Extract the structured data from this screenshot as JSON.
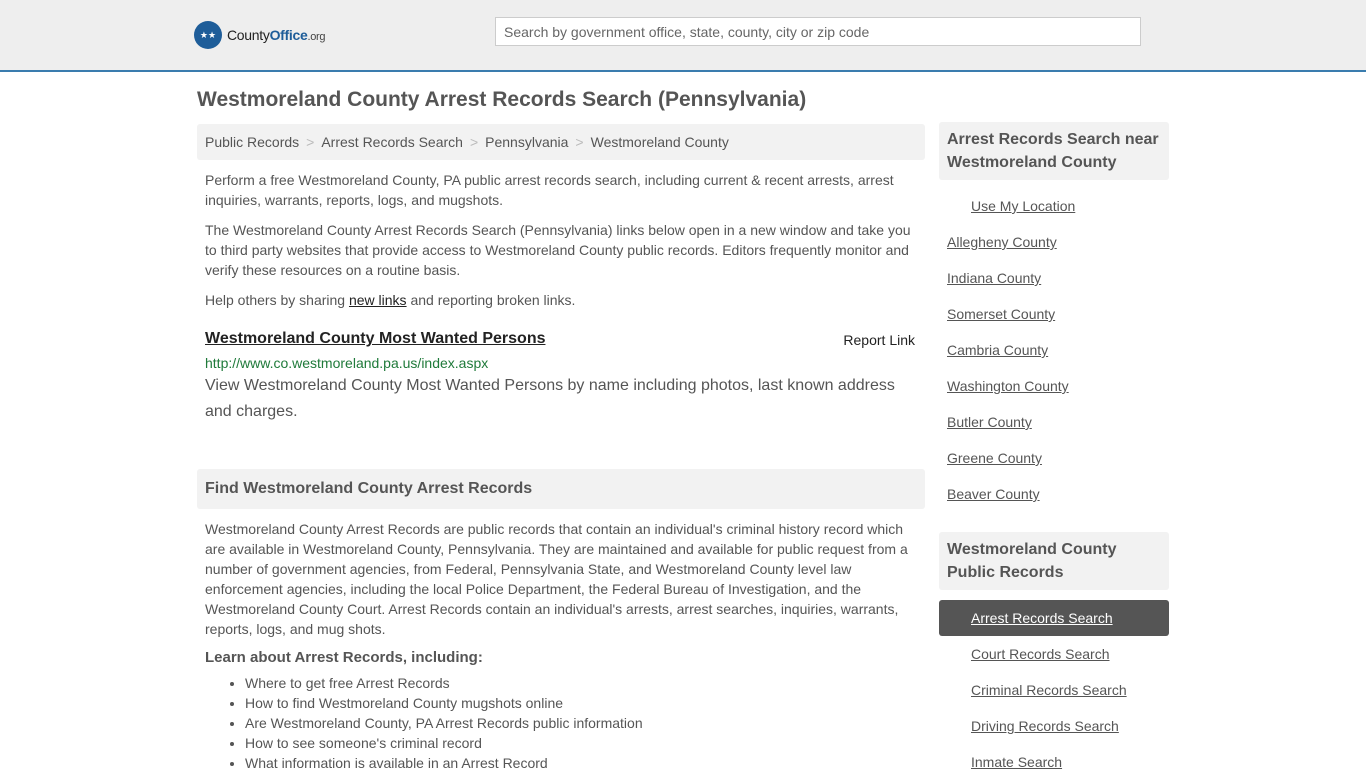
{
  "header": {
    "logo_icon": "eagle-stars-badge-icon",
    "logo_text_county": "County",
    "logo_text_office": "Office",
    "logo_text_org": ".org",
    "search_placeholder": "Search by government office, state, county, city or zip code"
  },
  "page_title": "Westmoreland County Arrest Records Search (Pennsylvania)",
  "breadcrumb": [
    {
      "label": "Public Records"
    },
    {
      "label": "Arrest Records Search"
    },
    {
      "label": "Pennsylvania"
    },
    {
      "label": "Westmoreland County"
    }
  ],
  "breadcrumb_separator": ">",
  "intro": {
    "p1": "Perform a free Westmoreland County, PA public arrest records search, including current & recent arrests, arrest inquiries, warrants, reports, logs, and mugshots.",
    "p2": "The Westmoreland County Arrest Records Search (Pennsylvania) links below open in a new window and take you to third party websites that provide access to Westmoreland County public records. Editors frequently monitor and verify these resources on a routine basis.",
    "p3_before": "Help others by sharing ",
    "p3_link": "new links",
    "p3_after": " and reporting broken links."
  },
  "resource": {
    "title": "Westmoreland County Most Wanted Persons",
    "report_label": "Report Link",
    "url": "http://www.co.westmoreland.pa.us/index.aspx",
    "description": "View Westmoreland County Most Wanted Persons by name including photos, last known address and charges."
  },
  "find_section": {
    "heading": "Find Westmoreland County Arrest Records",
    "body": "Westmoreland County Arrest Records are public records that contain an individual's criminal history record which are available in Westmoreland County, Pennsylvania. They are maintained and available for public request from a number of government agencies, from Federal, Pennsylvania State, and Westmoreland County level law enforcement agencies, including the local Police Department, the Federal Bureau of Investigation, and the Westmoreland County Court. Arrest Records contain an individual's arrests, arrest searches, inquiries, warrants, reports, logs, and mug shots.",
    "learn_heading": "Learn about Arrest Records, including:",
    "learn_items": [
      "Where to get free Arrest Records",
      "How to find Westmoreland County mugshots online",
      "Are Westmoreland County, PA Arrest Records public information",
      "How to see someone's criminal record",
      "What information is available in an Arrest Record"
    ]
  },
  "sidebar": {
    "nearby_heading": "Arrest Records Search near Westmoreland County",
    "use_location": "Use My Location",
    "nearby": [
      "Allegheny County",
      "Indiana County",
      "Somerset County",
      "Cambria County",
      "Washington County",
      "Butler County",
      "Greene County",
      "Beaver County"
    ],
    "records_heading": "Westmoreland County Public Records",
    "records": [
      {
        "label": "Arrest Records Search",
        "active": true
      },
      {
        "label": "Court Records Search",
        "active": false
      },
      {
        "label": "Criminal Records Search",
        "active": false
      },
      {
        "label": "Driving Records Search",
        "active": false
      },
      {
        "label": "Inmate Search",
        "active": false
      }
    ]
  }
}
